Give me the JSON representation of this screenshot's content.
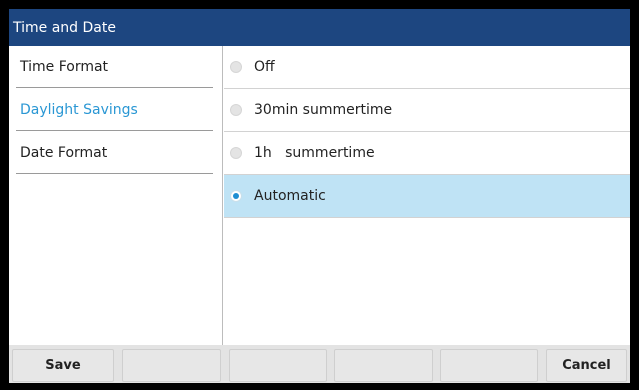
{
  "header": {
    "title": "Time and Date"
  },
  "sidebar": {
    "items": [
      {
        "label": "Time Format",
        "active": false
      },
      {
        "label": "Daylight Savings",
        "active": true
      },
      {
        "label": "Date Format",
        "active": false
      }
    ]
  },
  "options": {
    "items": [
      {
        "label": "Off",
        "selected": false
      },
      {
        "label": "30min summertime",
        "selected": false
      },
      {
        "label": "1h   summertime",
        "selected": false
      },
      {
        "label": "Automatic",
        "selected": true
      }
    ]
  },
  "softkeys": {
    "items": [
      {
        "label": "Save"
      },
      {
        "label": ""
      },
      {
        "label": ""
      },
      {
        "label": ""
      },
      {
        "label": ""
      },
      {
        "label": "Cancel"
      }
    ]
  },
  "colors": {
    "title_bar": "#1d4680",
    "active_text": "#2a97d4",
    "selected_row": "#bfe3f5",
    "radio_dot": "#1e8ed2"
  }
}
